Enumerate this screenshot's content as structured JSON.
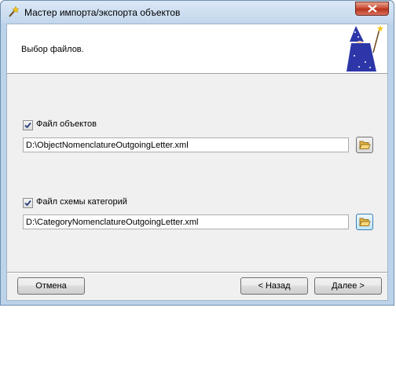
{
  "window": {
    "title": "Мастер импорта/экспорта объектов"
  },
  "header": {
    "text": "Выбор файлов."
  },
  "objects_file": {
    "checkbox_label": "Файл объектов",
    "checked": true,
    "path": "D:\\ObjectNomenclatureOutgoingLetter.xml"
  },
  "schema_file": {
    "checkbox_label": "Файл схемы категорий",
    "checked": true,
    "path": "D:\\CategoryNomenclatureOutgoingLetter.xml"
  },
  "buttons": {
    "cancel": "Отмена",
    "back": "< Назад",
    "next": "Далее >"
  },
  "colors": {
    "close_button": "#c7452b",
    "titlebar": "#c2d6ec",
    "wizard_robe": "#2c36a8"
  },
  "icons": [
    "wand-icon",
    "close-icon",
    "wizard-icon",
    "checkmark-icon",
    "folder-open-icon"
  ]
}
